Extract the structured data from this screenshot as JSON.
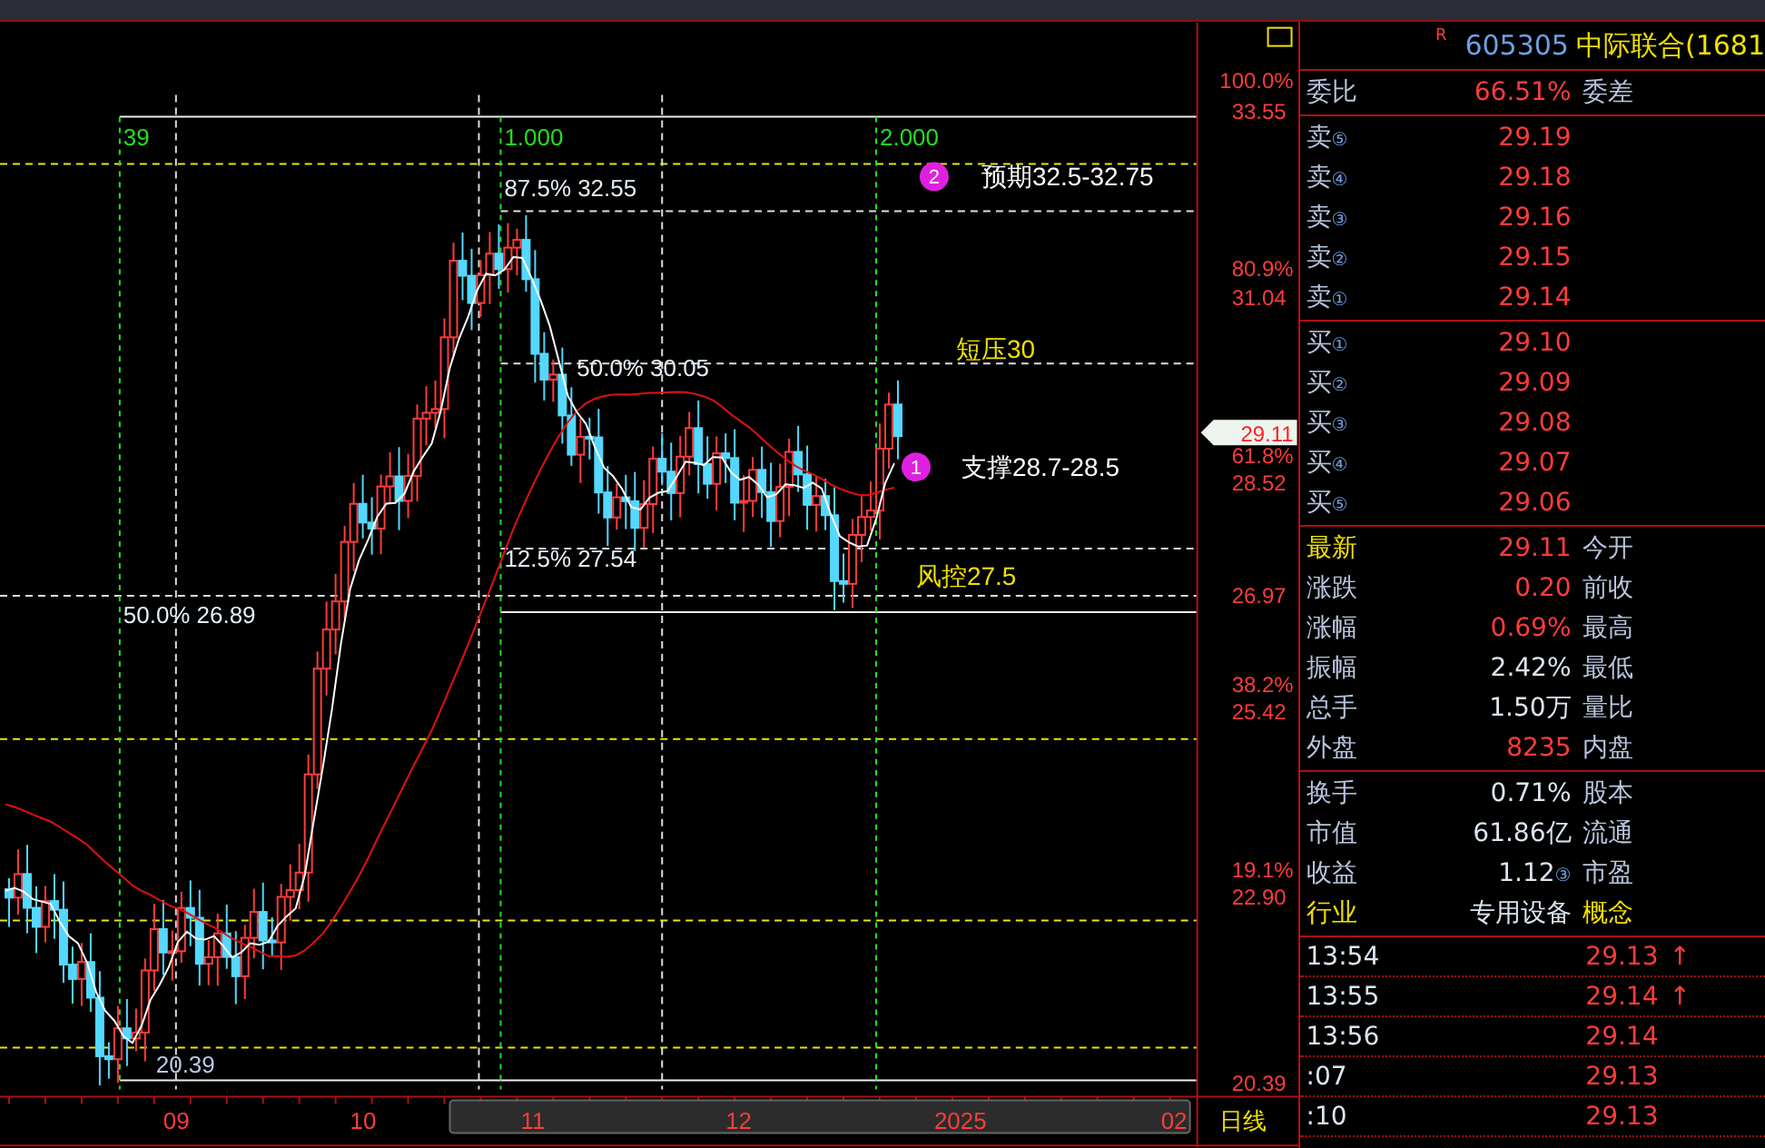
{
  "chart": {
    "grid_labels": [
      "39",
      "1.000",
      "2.000"
    ],
    "fib_levels": [
      "87.5% 32.55",
      "50.0% 30.05",
      "12.5% 27.54"
    ],
    "left_fib": "50.0% 26.89",
    "low_label": "20.39",
    "markers": [
      {
        "number": "2",
        "text": "预期32.5-32.75"
      },
      {
        "number": "1",
        "text": "支撑28.7-28.5"
      }
    ],
    "notes": [
      "短压30",
      "风控27.5"
    ]
  },
  "price_axis": {
    "labels": [
      {
        "percent": "100.0%",
        "price": "33.55"
      },
      {
        "percent": "80.9%",
        "price": "31.04"
      },
      {
        "percent": "61.8%",
        "price": "28.52"
      },
      {
        "price": "26.97"
      },
      {
        "percent": "38.2%",
        "price": "25.42"
      },
      {
        "percent": "19.1%",
        "price": "22.90"
      },
      {
        "price": "20.39"
      }
    ],
    "current_price": "29.11",
    "period": "日线"
  },
  "time_axis": [
    "09",
    "10",
    "11",
    "12",
    "2025",
    "02"
  ],
  "quote": {
    "code_mark": "R",
    "code": "605305",
    "name": "中际联合(1681",
    "ratio": {
      "label": "委比",
      "value": "66.51%",
      "side": "委差"
    },
    "asks": [
      {
        "label": "卖",
        "rank": "⑤",
        "price": "29.19"
      },
      {
        "label": "卖",
        "rank": "④",
        "price": "29.18"
      },
      {
        "label": "卖",
        "rank": "③",
        "price": "29.16"
      },
      {
        "label": "卖",
        "rank": "②",
        "price": "29.15"
      },
      {
        "label": "卖",
        "rank": "①",
        "price": "29.14"
      }
    ],
    "bids": [
      {
        "label": "买",
        "rank": "①",
        "price": "29.10"
      },
      {
        "label": "买",
        "rank": "②",
        "price": "29.09"
      },
      {
        "label": "买",
        "rank": "③",
        "price": "29.08"
      },
      {
        "label": "买",
        "rank": "④",
        "price": "29.07"
      },
      {
        "label": "买",
        "rank": "⑤",
        "price": "29.06"
      }
    ],
    "stats": [
      {
        "label": "最新",
        "label_highlighted": true,
        "value": "29.11",
        "color": "#ff3c3c",
        "side": "今开",
        "side_highlighted": false
      },
      {
        "label": "涨跌",
        "label_highlighted": false,
        "value": "0.20",
        "color": "#ff3c3c",
        "side": "前收",
        "side_highlighted": false
      },
      {
        "label": "涨幅",
        "label_highlighted": false,
        "value": "0.69%",
        "color": "#ff3c3c",
        "side": "最高",
        "side_highlighted": false
      },
      {
        "label": "振幅",
        "label_highlighted": false,
        "value": "2.42%",
        "color": "#dce4f0",
        "side": "最低",
        "side_highlighted": false
      },
      {
        "label": "总手",
        "label_highlighted": false,
        "value": "1.50万",
        "color": "#dce4f0",
        "side": "量比",
        "side_highlighted": false
      },
      {
        "label": "外盘",
        "label_highlighted": false,
        "value": "8235",
        "color": "#ff3c3c",
        "side": "内盘",
        "side_highlighted": false
      }
    ],
    "fundamentals": [
      {
        "label": "换手",
        "label_highlighted": false,
        "value": "0.71%",
        "color": "#dce4f0",
        "side": "股本",
        "side_highlighted": false
      },
      {
        "label": "市值",
        "label_highlighted": false,
        "value": "61.86亿",
        "color": "#dce4f0",
        "side": "流通",
        "side_highlighted": false
      },
      {
        "label": "收益",
        "label_highlighted": false,
        "value": "1.12",
        "note": "③",
        "color": "#dce4f0",
        "side": "市盈",
        "side_highlighted": false
      },
      {
        "label": "行业",
        "label_highlighted": true,
        "value": "专用设备",
        "color": "#dce4f0",
        "side": "概念",
        "side_highlighted": true
      }
    ],
    "trades": [
      {
        "time": "13:54",
        "price": "29.13",
        "arrow": "↑"
      },
      {
        "time": "13:55",
        "price": "29.14",
        "arrow": "↑"
      },
      {
        "time": "13:56",
        "price": "29.14"
      },
      {
        "time": ":07",
        "price": "29.13"
      },
      {
        "time": ":10",
        "price": "29.13"
      }
    ]
  }
}
